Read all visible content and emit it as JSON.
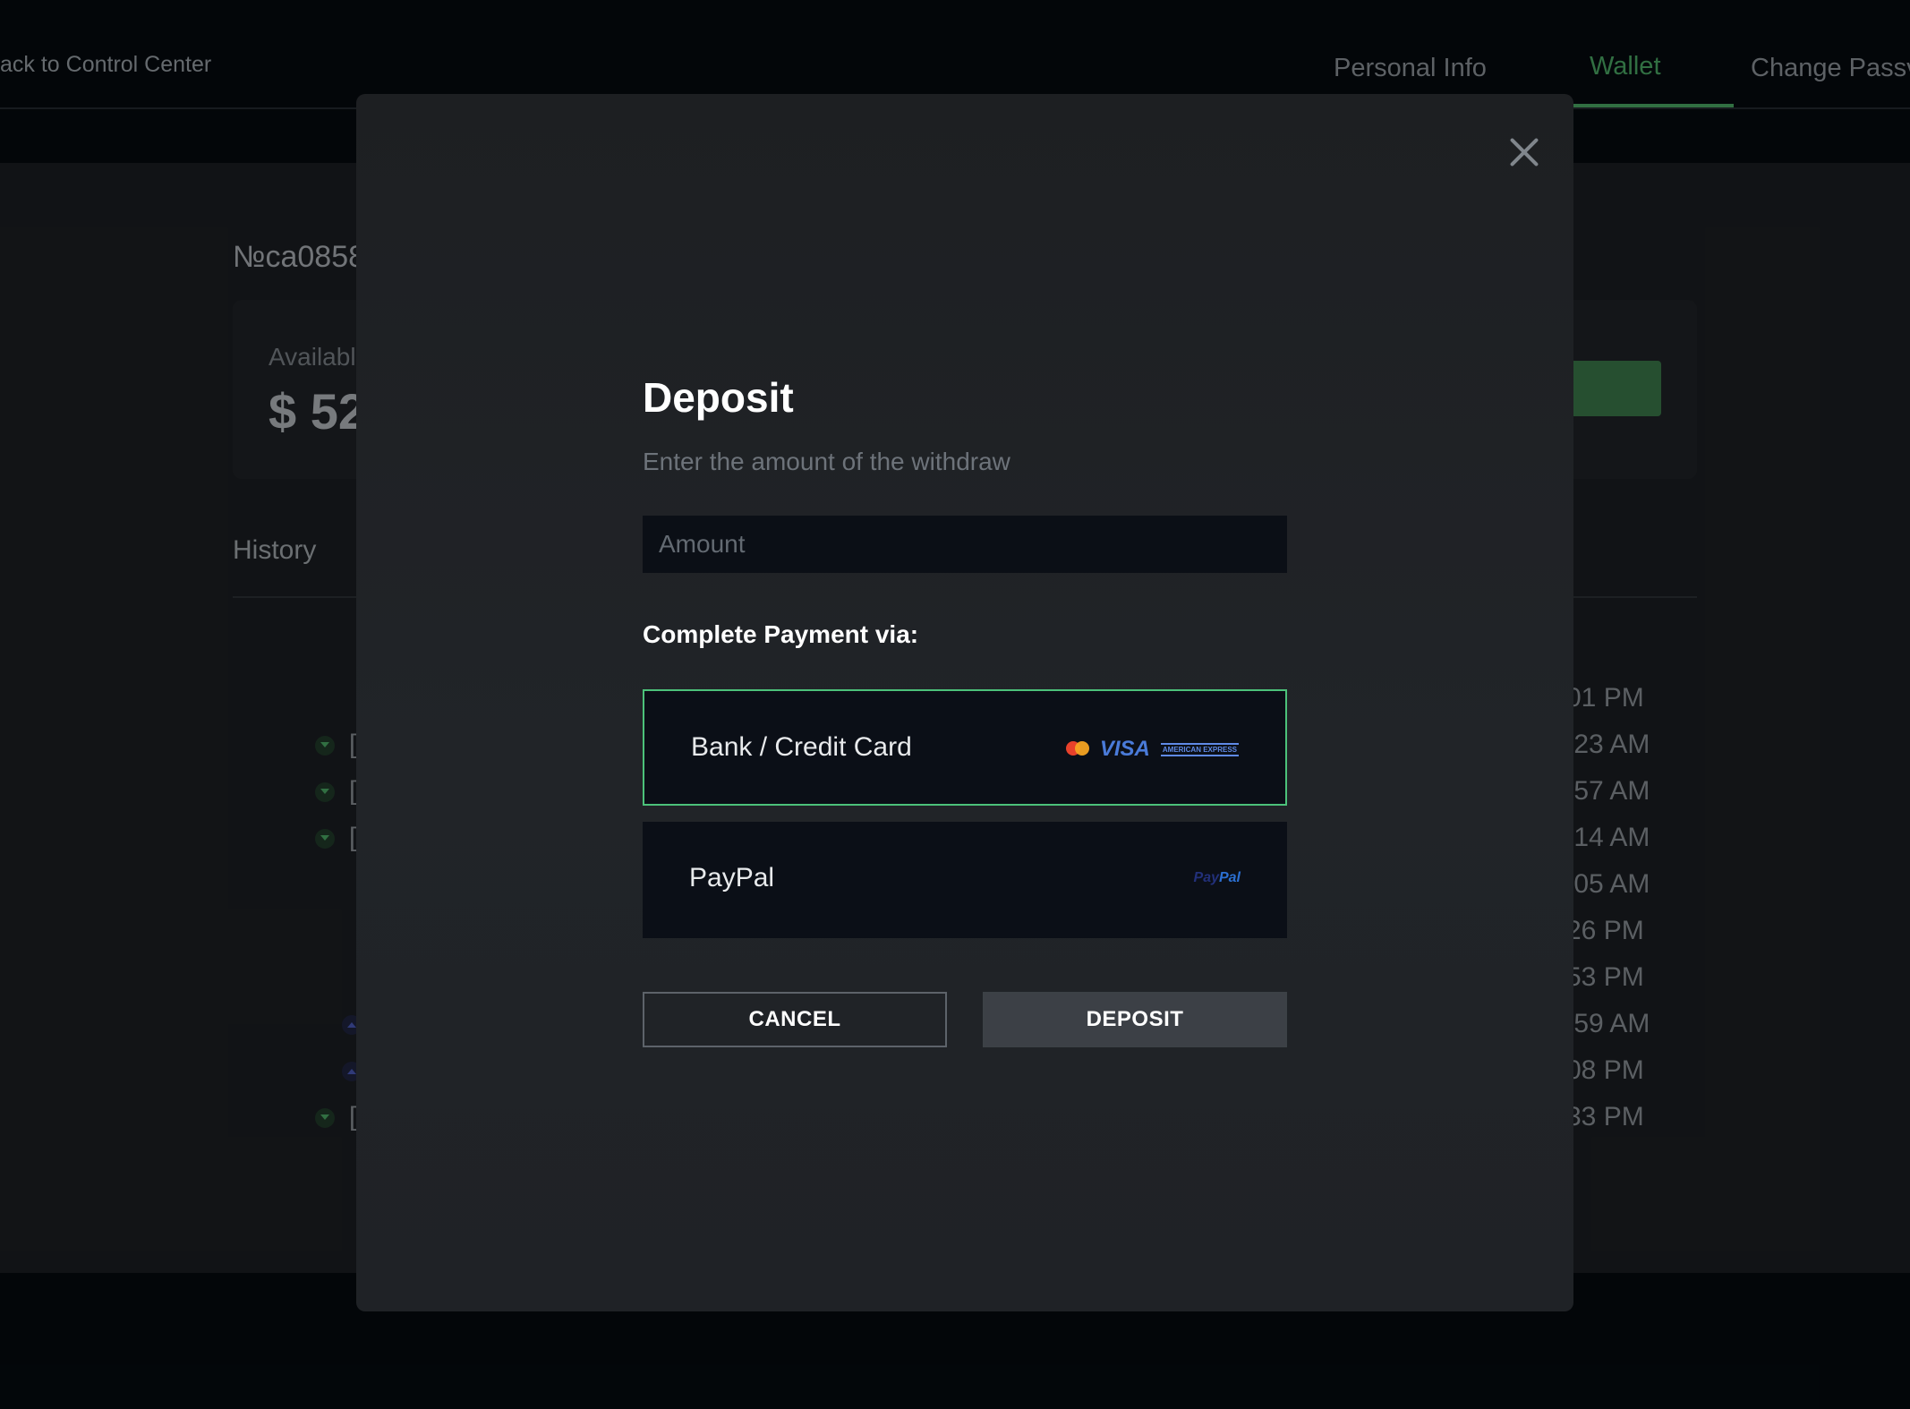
{
  "header": {
    "back_link": "ack to Control Center",
    "tabs": [
      {
        "label": "Personal Info",
        "active": false
      },
      {
        "label": "Wallet",
        "active": true
      },
      {
        "label": "Change Passv",
        "active": false
      }
    ]
  },
  "wallet": {
    "id": "№ca0858",
    "available_label": "Availabl",
    "available_amount": "$ 52"
  },
  "history": {
    "title": "History",
    "times": [
      "01 PM",
      ":23 AM",
      ":57 AM",
      ":14 AM",
      ":05 AM",
      "26 PM",
      "53 PM",
      ":59 AM",
      "08 PM",
      "33 PM"
    ],
    "letter": "[",
    "accent_in": "#4cab66",
    "accent_out": "#4a5ab8"
  },
  "modal": {
    "title": "Deposit",
    "subtitle": "Enter the amount of the withdraw",
    "amount_placeholder": "Amount",
    "payment_label": "Complete Payment via:",
    "options": [
      {
        "label": "Bank / Credit Card",
        "selected": true,
        "logos": [
          "mastercard-icon",
          "VISA",
          "AMERICAN EXPRESS"
        ]
      },
      {
        "label": "PayPal",
        "selected": false,
        "logo": {
          "pay": "Pay",
          "pal": "Pal"
        }
      }
    ],
    "cancel_label": "CANCEL",
    "deposit_label": "DEPOSIT",
    "close_icon": "close-icon",
    "selected_border_color": "#4cc27a"
  }
}
